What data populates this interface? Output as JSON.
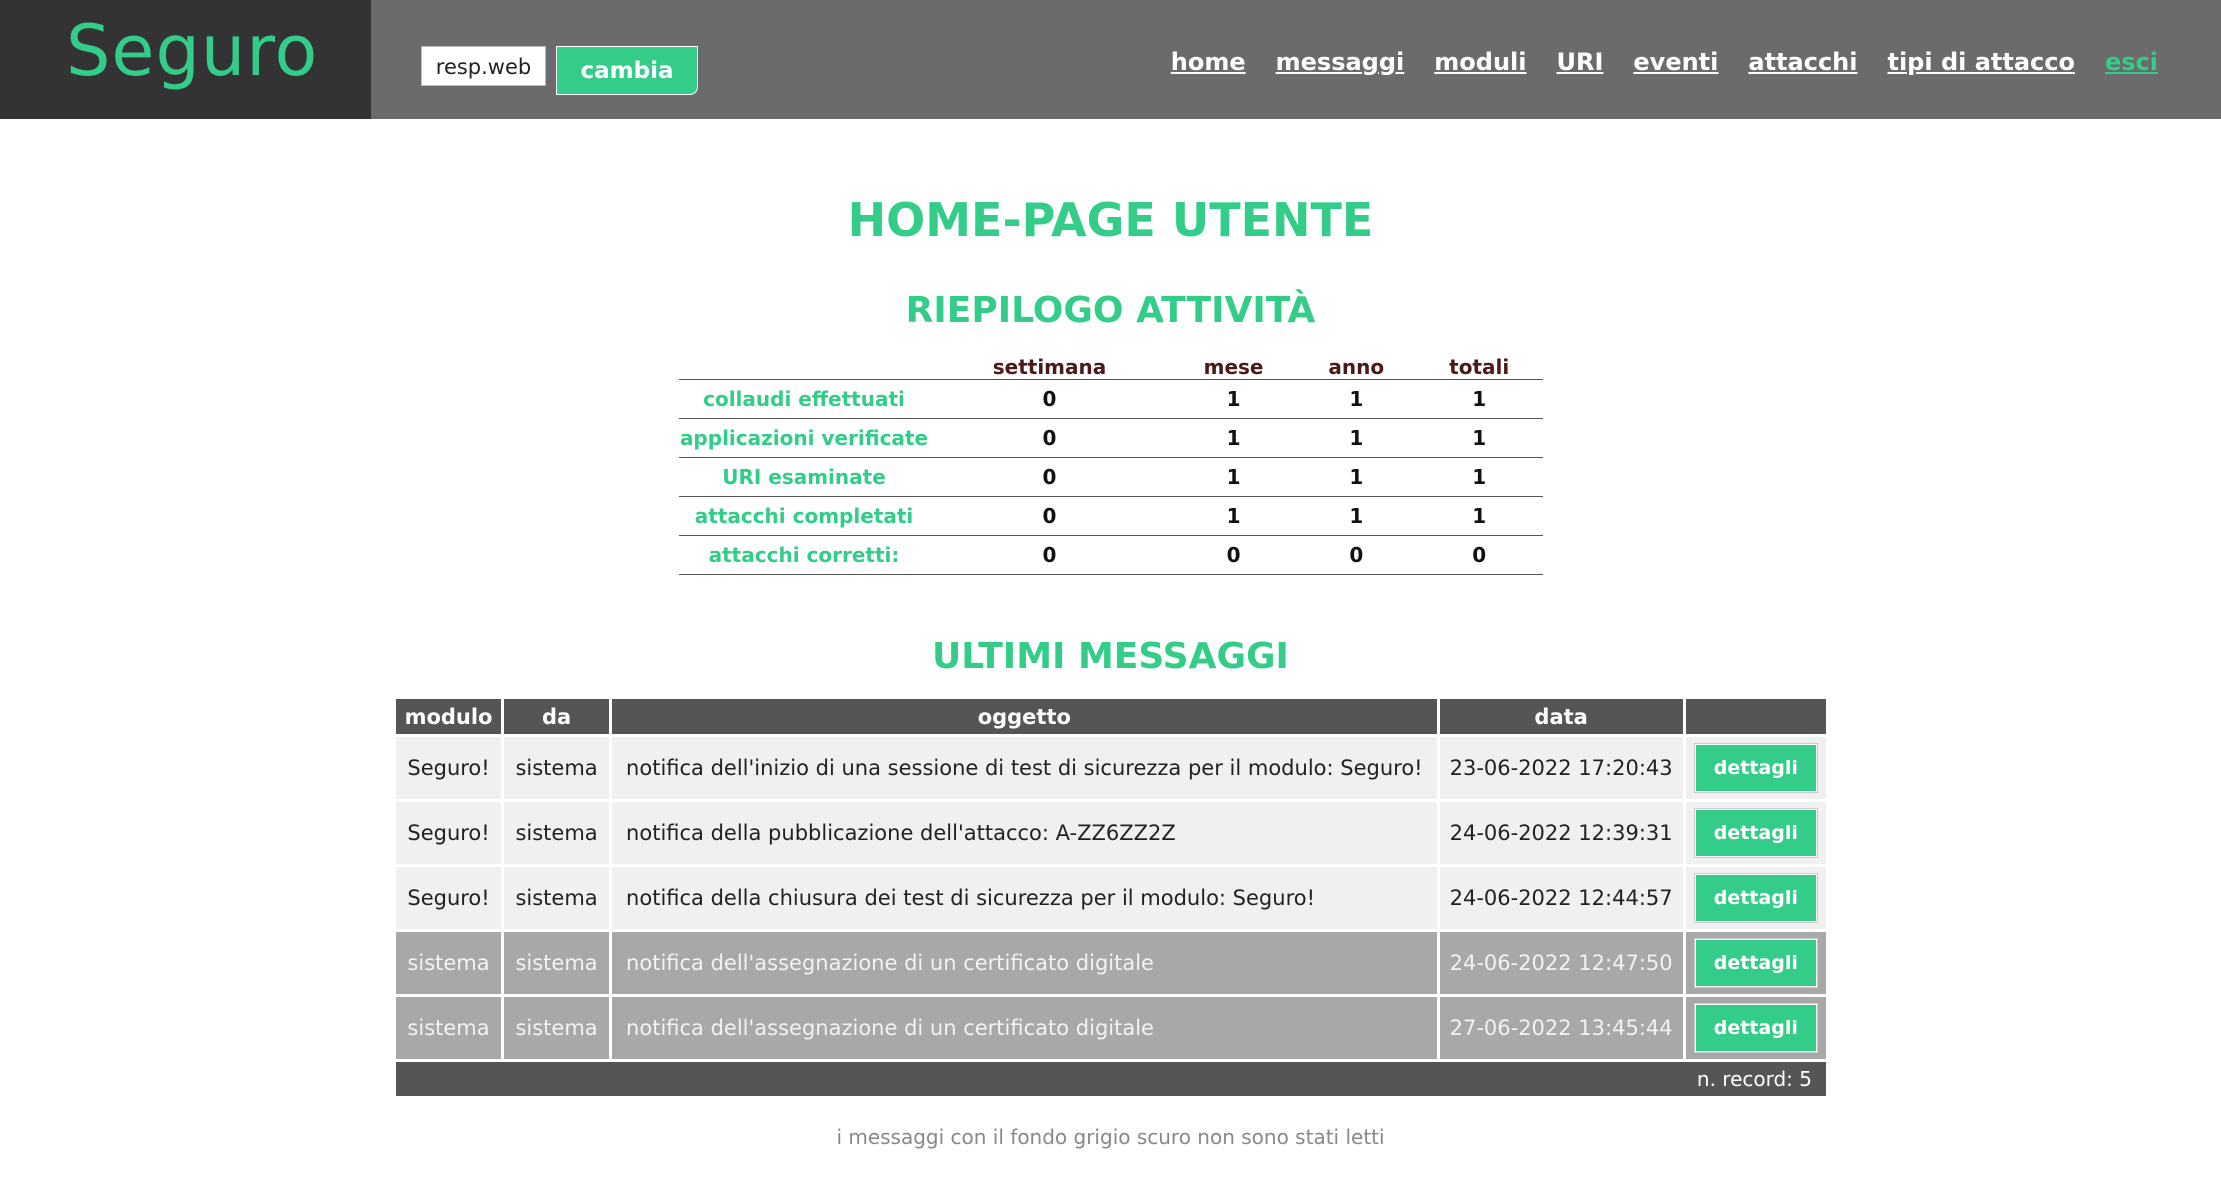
{
  "app": {
    "brand": "Seguro"
  },
  "header": {
    "role_value": "resp.web",
    "change_label": "cambia",
    "nav": [
      "home",
      "messaggi",
      "moduli",
      "URI",
      "eventi",
      "attacchi",
      "tipi di attacco"
    ],
    "exit_label": "esci"
  },
  "page": {
    "title": "HOME-PAGE UTENTE"
  },
  "summary": {
    "title": "RIEPILOGO ATTIVITÀ",
    "columns": [
      "settimana",
      "mese",
      "anno",
      "totali"
    ],
    "rows": [
      {
        "label": "collaudi effettuati",
        "values": [
          "0",
          "1",
          "1",
          "1"
        ]
      },
      {
        "label": "applicazioni verificate",
        "values": [
          "0",
          "1",
          "1",
          "1"
        ]
      },
      {
        "label": "URI esaminate",
        "values": [
          "0",
          "1",
          "1",
          "1"
        ]
      },
      {
        "label": "attacchi completati",
        "values": [
          "0",
          "1",
          "1",
          "1"
        ]
      },
      {
        "label": "attacchi corretti:",
        "values": [
          "0",
          "0",
          "0",
          "0"
        ]
      }
    ]
  },
  "messages": {
    "title": "ULTIMI MESSAGGI",
    "columns": [
      "modulo",
      "da",
      "oggetto",
      "data",
      ""
    ],
    "button_label": "dettagli",
    "rows": [
      {
        "modulo": "Seguro!",
        "da": "sistema",
        "oggetto": "notifica dell'inizio di una sessione di test di sicurezza per il modulo: Seguro!",
        "data": "23-06-2022 17:20:43",
        "unread": false
      },
      {
        "modulo": "Seguro!",
        "da": "sistema",
        "oggetto": "notifica della pubblicazione dell'attacco: A-ZZ6ZZ2Z",
        "data": "24-06-2022 12:39:31",
        "unread": false
      },
      {
        "modulo": "Seguro!",
        "da": "sistema",
        "oggetto": "notifica della chiusura dei test di sicurezza per il modulo: Seguro!",
        "data": "24-06-2022 12:44:57",
        "unread": false
      },
      {
        "modulo": "sistema",
        "da": "sistema",
        "oggetto": "notifica dell'assegnazione di un certificato digitale",
        "data": "24-06-2022 12:47:50",
        "unread": true
      },
      {
        "modulo": "sistema",
        "da": "sistema",
        "oggetto": "notifica dell'assegnazione di un certificato digitale",
        "data": "27-06-2022 13:45:44",
        "unread": true
      }
    ],
    "footer": "n. record: 5"
  },
  "note": "i messaggi con il fondo grigio scuro non sono stati letti",
  "colors": {
    "accent": "#33cc88",
    "header": "#6b6b6b",
    "brand_bg": "#333333",
    "unread_row": "#a8a8a8"
  }
}
